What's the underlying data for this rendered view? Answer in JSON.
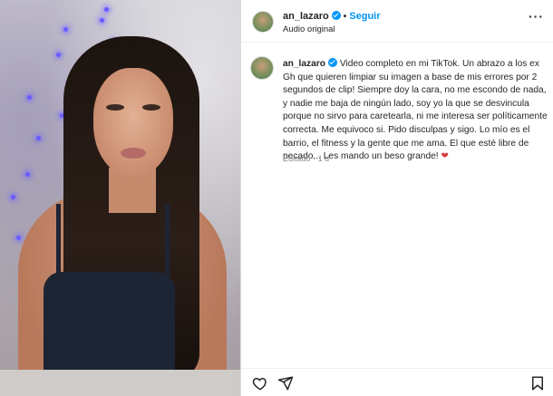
{
  "post": {
    "username": "an_lazaro",
    "follow_label": "Seguir",
    "separator": "•",
    "audio_label": "Audio original",
    "more_label": "···"
  },
  "caption": {
    "username": "an_lazaro",
    "text": "Video completo en mi TikTok. Un abrazo a los ex Gh que quieren limpiar su imagen a base de mis errores por 2 segundos de clip! Siempre doy la cara, no me escondo de nada, y nadie me baja de ningún lado, soy yo la que se desvincula porque no sirvo para caretearla, ni me interesa ser políticamente correcta. Me equivoco si. Pido disculpas y sigo. Lo mío es el barrio, el fitness y la gente que me ama. El que esté libre de pecado... Les mando un beso grande!",
    "emoji": "❤",
    "edited_label": "Editado",
    "meta_sep": "·",
    "time_ago": "1 d"
  },
  "icons": {
    "like": "heart-icon",
    "share": "send-icon",
    "save": "bookmark-icon",
    "verified": "verified-badge-icon",
    "more": "more-options-icon"
  },
  "colors": {
    "link_blue": "#0095f6",
    "text": "#262626",
    "muted": "#8e8e8e",
    "border": "#dbdbdb",
    "emoji_red": "#d63a3a"
  }
}
